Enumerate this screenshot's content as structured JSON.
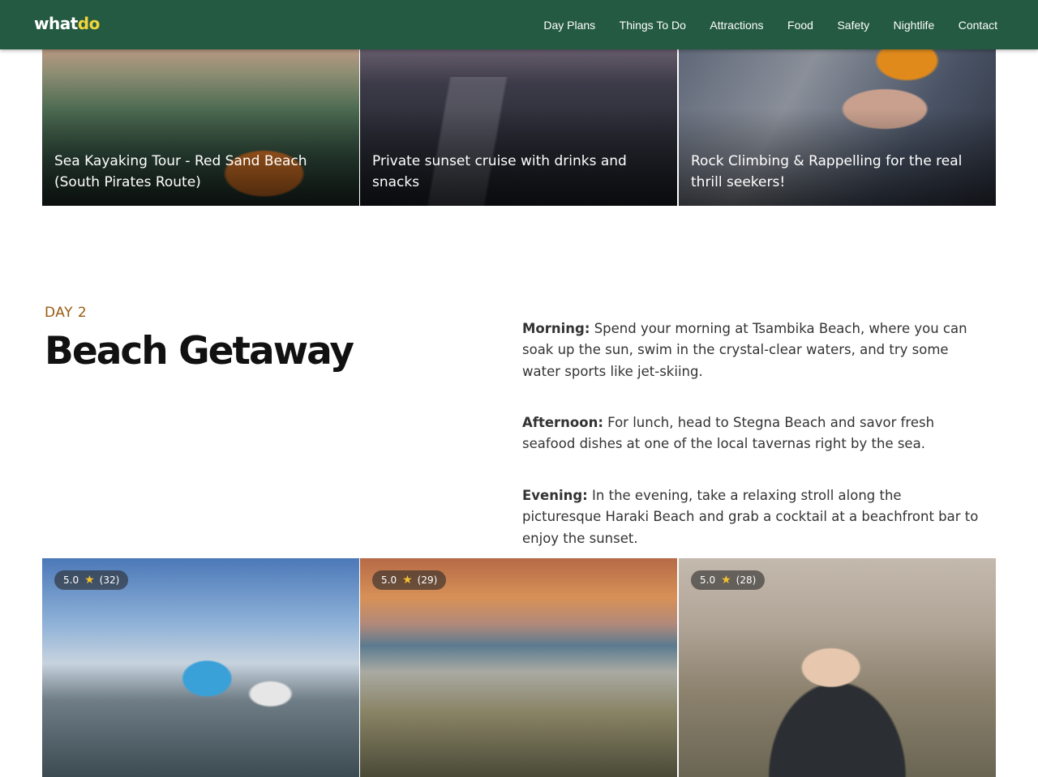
{
  "header": {
    "logo_part1": "what",
    "logo_part2": "do",
    "nav": [
      "Day Plans",
      "Things To Do",
      "Attractions",
      "Food",
      "Safety",
      "Nightlife",
      "Contact"
    ]
  },
  "top_cards": [
    {
      "title": "Sea Kayaking Tour - Red Sand Beach (South Pirates Route)"
    },
    {
      "title": "Private sunset cruise with drinks and snacks"
    },
    {
      "title": "Rock Climbing & Rappelling for the real thrill seekers!"
    }
  ],
  "day": {
    "label": "DAY 2",
    "title": "Beach Getaway",
    "morning_label": "Morning:",
    "morning_text": " Spend your morning at Tsambika Beach, where you can soak up the sun, swim in the crystal-clear waters, and try some water sports like jet-skiing.",
    "afternoon_label": "Afternoon:",
    "afternoon_text": " For lunch, head to Stegna Beach and savor fresh seafood dishes at one of the local tavernas right by the sea.",
    "evening_label": "Evening:",
    "evening_text": " In the evening, take a relaxing stroll along the picturesque Haraki Beach and grab a cocktail at a beachfront bar to enjoy the sunset."
  },
  "bottom_cards": [
    {
      "rating": "5.0",
      "count": "(32)"
    },
    {
      "rating": "5.0",
      "count": "(29)"
    },
    {
      "rating": "5.0",
      "count": "(28)"
    }
  ],
  "icons": {
    "star": "star-icon"
  },
  "colors": {
    "header_bg": "#245a41",
    "logo_accent": "#f2d53c",
    "day_label": "#9a5a0f"
  }
}
